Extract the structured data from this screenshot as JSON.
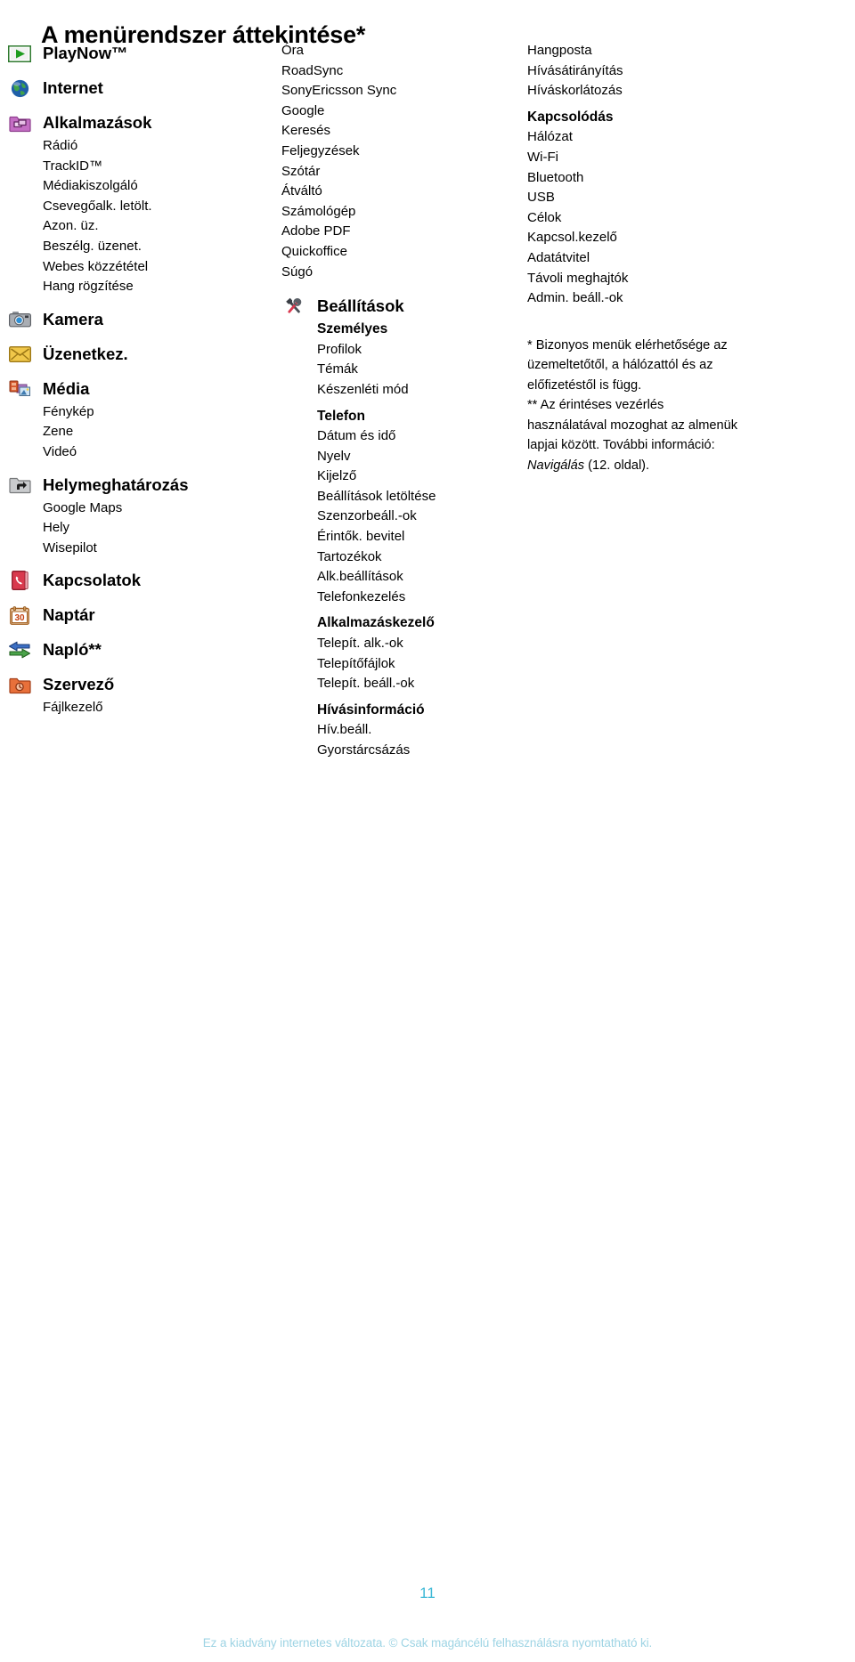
{
  "title": "A menürendszer áttekintése*",
  "colors": {
    "page_number": "#3fb9d6",
    "copyright": "#9ed4e4",
    "text": "#000000",
    "background": "#ffffff"
  },
  "column1": {
    "groups": [
      {
        "icon": "playnow-icon",
        "title": "PlayNow™",
        "children": []
      },
      {
        "icon": "internet-globe-icon",
        "title": "Internet",
        "children": []
      },
      {
        "icon": "applications-folder-icon",
        "title": "Alkalmazások",
        "children": [
          "Rádió",
          "TrackID™",
          "Médiakiszolgáló",
          "Csevegőalk. letölt.",
          "Azon. üz.",
          "Beszélg. üzenet.",
          "Webes közzététel",
          "Hang rögzítése"
        ]
      },
      {
        "icon": "camera-icon",
        "title": "Kamera",
        "children": []
      },
      {
        "icon": "messaging-envelope-icon",
        "title": "Üzenetkez.",
        "children": []
      },
      {
        "icon": "media-icon",
        "title": "Média",
        "children": [
          "Fénykép",
          "Zene",
          "Videó"
        ]
      },
      {
        "icon": "location-folder-icon",
        "title": "Helymeghatározás",
        "children": [
          "Google Maps",
          "Hely",
          "Wisepilot"
        ]
      },
      {
        "icon": "contacts-icon",
        "title": "Kapcsolatok",
        "children": []
      },
      {
        "icon": "calendar-icon",
        "title": "Naptár",
        "children": []
      },
      {
        "icon": "calllog-arrows-icon",
        "title": "Napló**",
        "children": []
      },
      {
        "icon": "organizer-folder-icon",
        "title": "Szervező",
        "children": [
          "Fájlkezelő"
        ]
      }
    ]
  },
  "column2": {
    "top_items": [
      "Óra",
      "RoadSync",
      "SonyEricsson Sync",
      "Google",
      "Keresés",
      "Feljegyzések",
      "Szótár",
      "Átváltó",
      "Számológép",
      "Adobe PDF",
      "Quickoffice",
      "Súgó"
    ],
    "settings": {
      "icon": "settings-tools-icon",
      "title": "Beállítások",
      "sections": [
        {
          "heading": "Személyes",
          "items": [
            "Profilok",
            "Témák",
            "Készenléti mód"
          ]
        },
        {
          "heading": "Telefon",
          "items": [
            "Dátum és idő",
            "Nyelv",
            "Kijelző",
            "Beállítások letöltése",
            "Szenzorbeáll.-ok",
            "Érintők. bevitel",
            "Tartozékok",
            "Alk.beállítások",
            "Telefonkezelés"
          ]
        },
        {
          "heading": "Alkalmazáskezelő",
          "items": [
            "Telepít. alk.-ok",
            "Telepítőfájlok",
            "Telepít. beáll.-ok"
          ]
        },
        {
          "heading": "Hívásinformáció",
          "items": [
            "Hív.beáll.",
            "Gyorstárcsázás"
          ]
        }
      ]
    }
  },
  "column3": {
    "top_items": [
      "Hangposta",
      "Hívásátirányítás",
      "Híváskorlátozás"
    ],
    "sections": [
      {
        "heading": "Kapcsolódás",
        "items": [
          "Hálózat",
          "Wi-Fi",
          "Bluetooth",
          "USB",
          "Célok",
          "Kapcsol.kezelő",
          "Adatátvitel",
          "Távoli meghajtók",
          "Admin. beáll.-ok"
        ]
      }
    ],
    "footnotes": {
      "single_star": "* Bizonyos menük elérhetősége az üzemeltetőtől, a hálózattól és az előfizetéstől is függ.",
      "double_star_before": "** Az érintéses vezérlés használatával mozoghat az almenük lapjai között. További információ: ",
      "double_star_italic": "Navigálás",
      "double_star_after": " (12. oldal)."
    }
  },
  "footer": {
    "page_number": "11",
    "copyright": "Ez a kiadvány internetes változata. © Csak magáncélú felhasználásra nyomtatható ki."
  }
}
